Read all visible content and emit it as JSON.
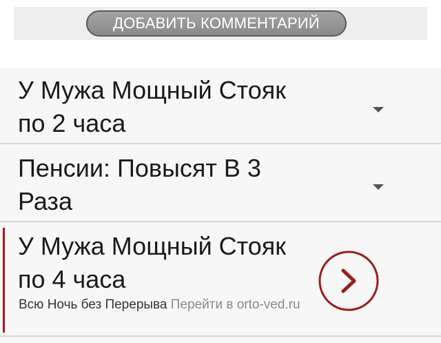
{
  "comment_button": {
    "label": "ДОБАВИТЬ КОММЕНТАРИЙ"
  },
  "ads": {
    "info_icon": "info-icon",
    "rows": [
      {
        "title": "У Мужа Мощный Стояк по 2 часа"
      },
      {
        "title": "Пенсии: Повысят В 3 Раза"
      }
    ],
    "featured": {
      "title": "У Мужа Мощный Стояк по 4 часа",
      "description": "Всю Ночь без Перерыва",
      "link_text": "Перейти в orto-ved.ru",
      "accent_color": "#9b1c1c"
    }
  }
}
